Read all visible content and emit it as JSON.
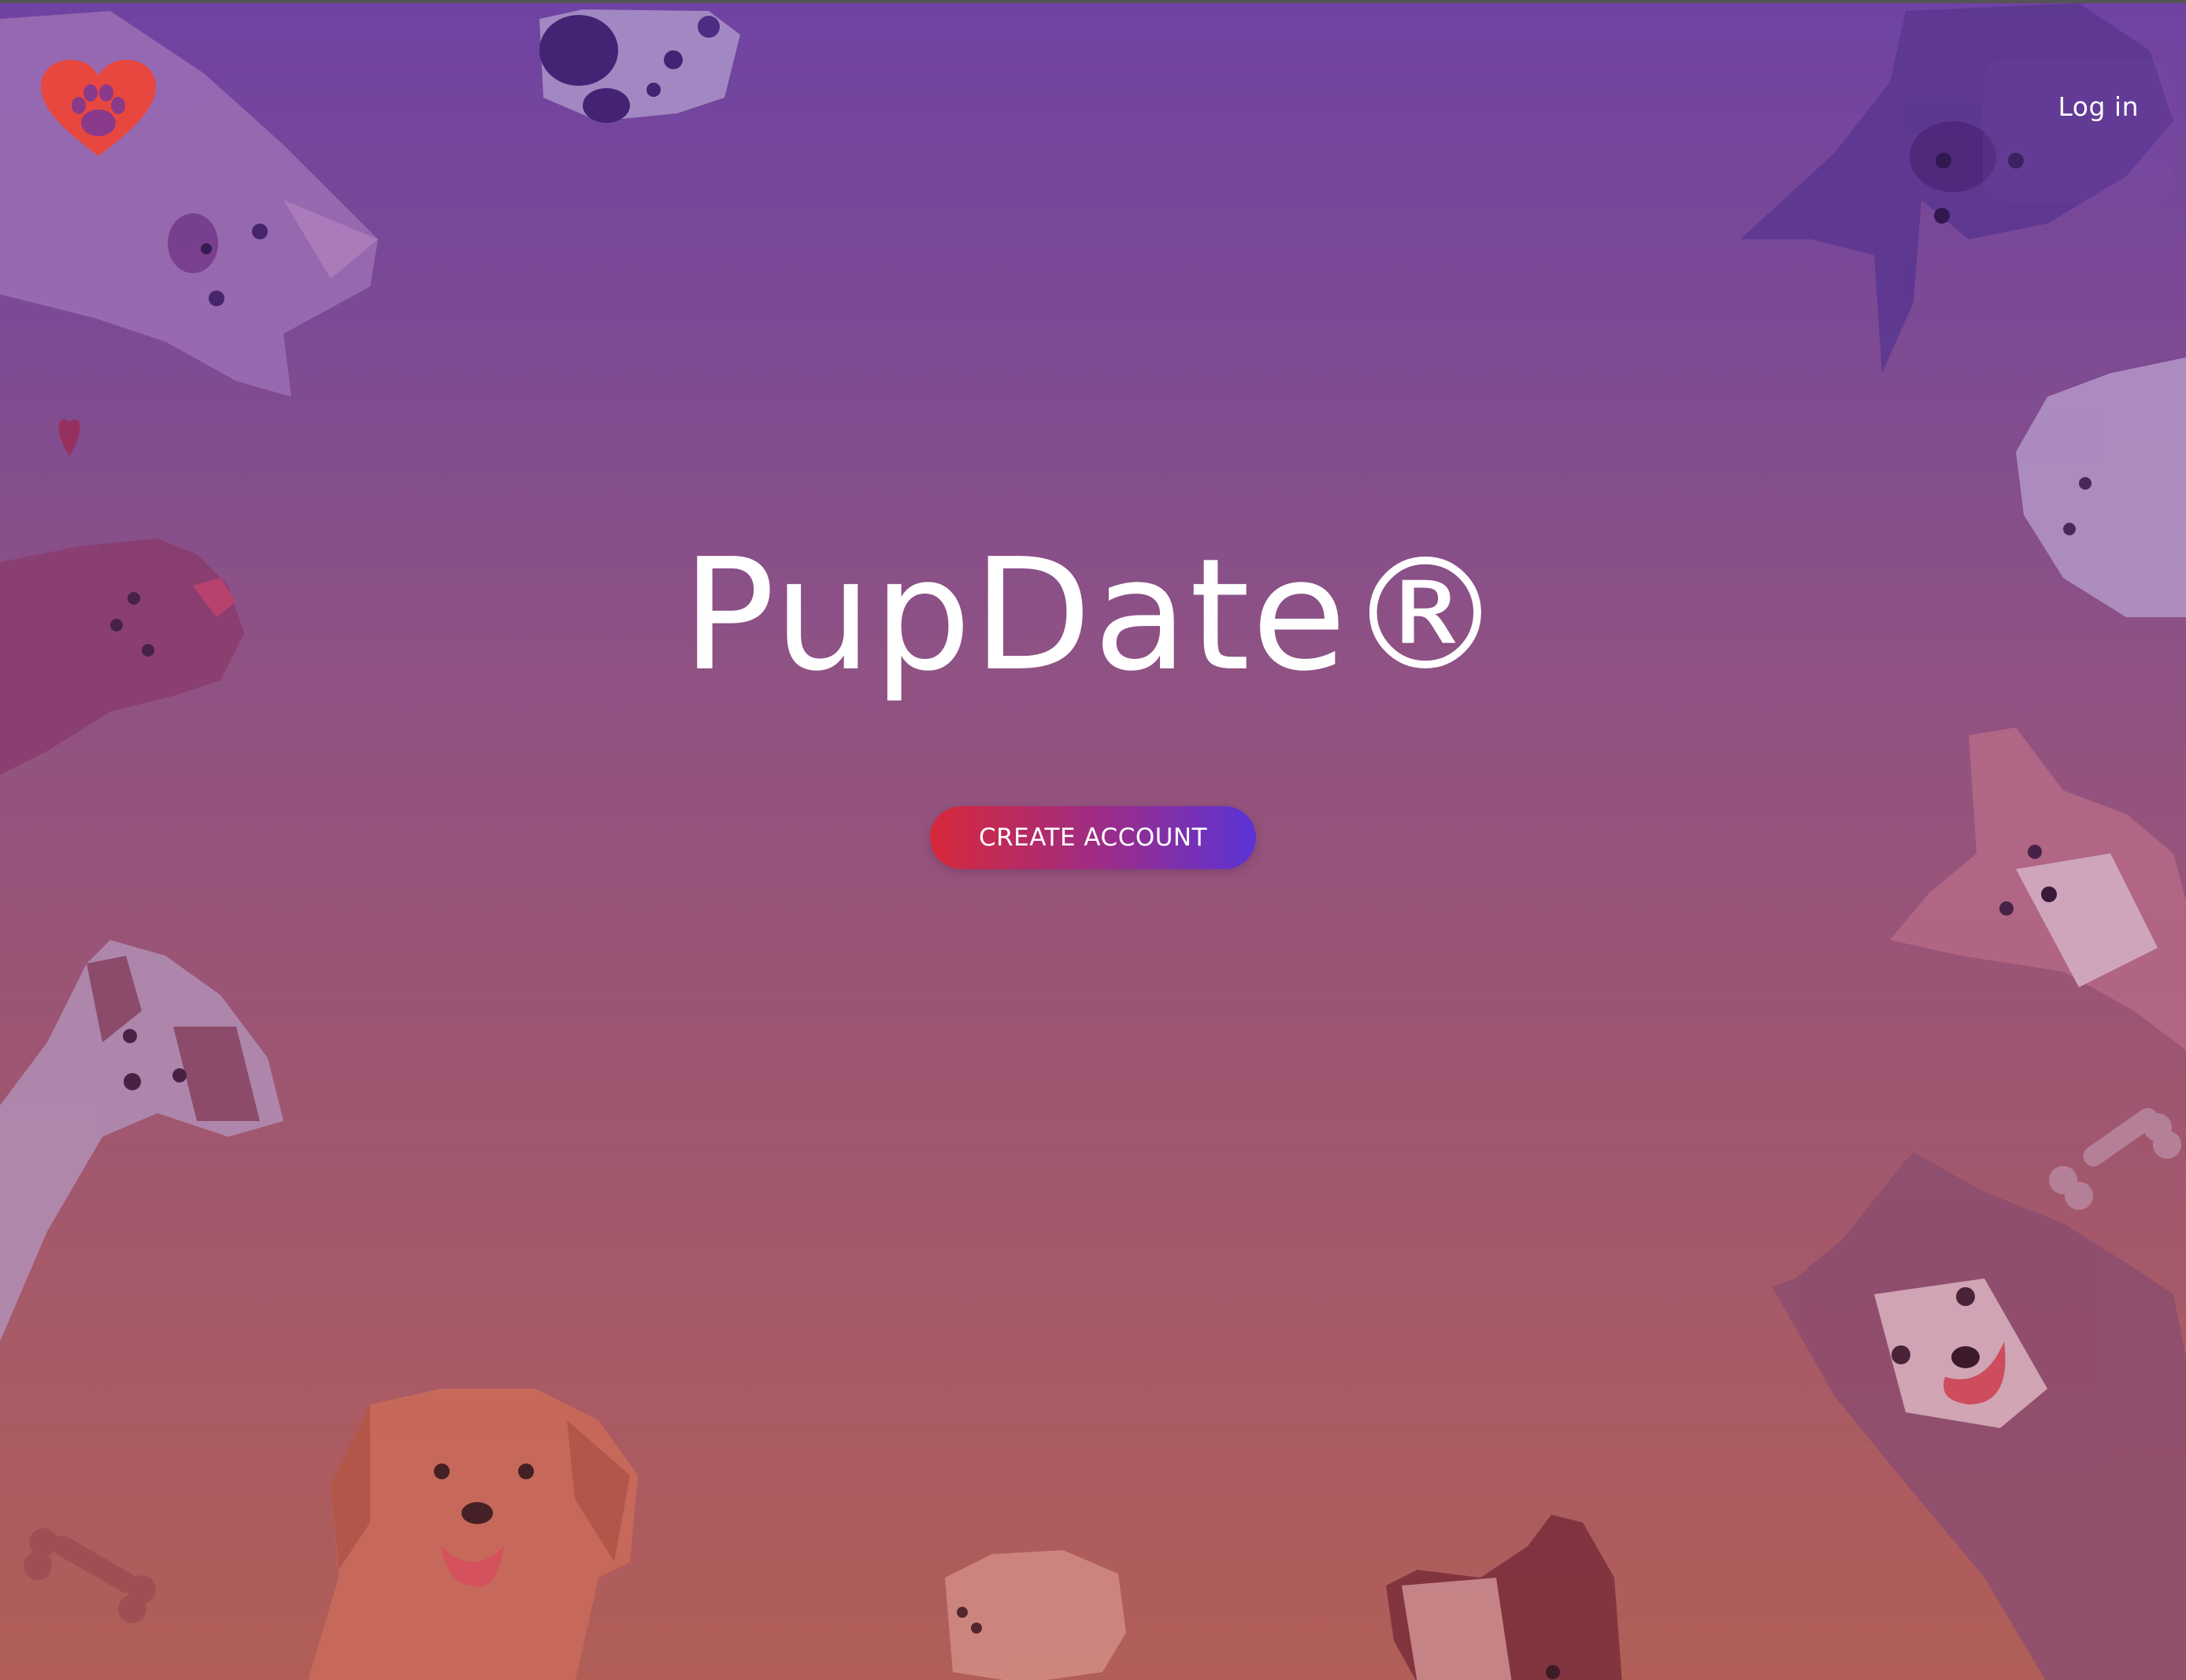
{
  "app": {
    "brand_name": "PupDate®",
    "logo_icon": "heart-paw-icon",
    "logo_color": "#e8473f"
  },
  "header": {
    "login_label": "Log in"
  },
  "hero": {
    "cta_label": "CREATE ACCOUNT"
  },
  "theme": {
    "gradient_top": "#6f43a3",
    "gradient_bottom": "#b15e57",
    "cta_gradient_start": "#d8283a",
    "cta_gradient_end": "#5b33d6",
    "text_color": "#ffffff"
  },
  "decorations": [
    {
      "name": "shiba-dog-illustration"
    },
    {
      "name": "dalmatian-dog-illustration"
    },
    {
      "name": "yorkshire-dog-illustration"
    },
    {
      "name": "jack-russell-dog-illustration"
    },
    {
      "name": "golden-retriever-illustration"
    },
    {
      "name": "pomeranian-illustration"
    },
    {
      "name": "french-bulldog-illustration"
    },
    {
      "name": "husky-dog-illustration"
    },
    {
      "name": "corgi-dog-illustration"
    },
    {
      "name": "poodle-dog-illustration"
    },
    {
      "name": "dark-terrier-illustration"
    },
    {
      "name": "dog-bone-icon"
    },
    {
      "name": "small-heart-icon"
    }
  ]
}
